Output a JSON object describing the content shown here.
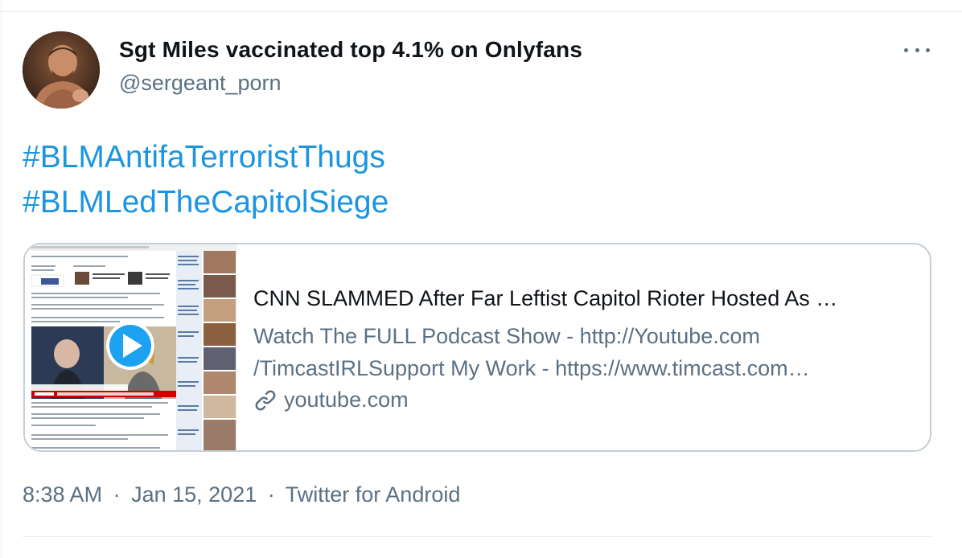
{
  "author": {
    "display_name": "Sgt Miles vaccinated top 4.1% on Onlyfans",
    "handle": "@sergeant_porn"
  },
  "tweet": {
    "hashtags": [
      "#BLMAntifaTerroristThugs",
      "#BLMLedTheCapitolSiege"
    ]
  },
  "card": {
    "title": "CNN SLAMMED After Far Leftist Capitol Rioter Hosted As …",
    "description_lines": [
      "Watch The FULL Podcast Show - http://Youtube.com",
      "/TimcastIRLSupport My Work - https://www.timcast.com…"
    ],
    "domain": "youtube.com"
  },
  "meta": {
    "time": "8:38 AM",
    "date": "Jan 15, 2021",
    "source": "Twitter for Android",
    "separator": "·"
  },
  "colors": {
    "hashtag": "#1b95e0",
    "secondary_text": "#5b7083",
    "card_border": "#c4cfd6",
    "play_button": "#1da1f2"
  }
}
